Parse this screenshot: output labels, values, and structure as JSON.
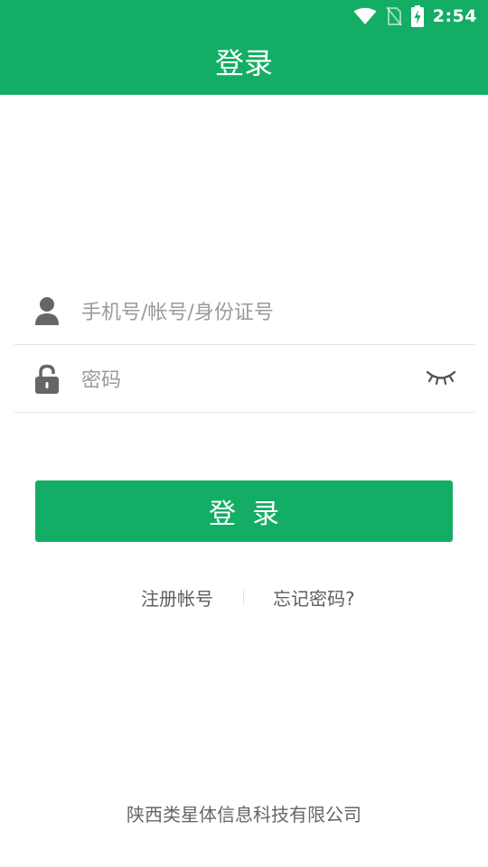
{
  "status_bar": {
    "time": "2:54",
    "icons": [
      "wifi-icon",
      "no-sim-icon",
      "battery-charging-icon"
    ]
  },
  "header": {
    "title": "登录"
  },
  "form": {
    "account": {
      "icon": "person-icon",
      "placeholder": "手机号/帐号/身份证号",
      "value": ""
    },
    "password": {
      "icon": "lock-icon",
      "placeholder": "密码",
      "value": "",
      "visibility_icon": "eye-closed-icon"
    },
    "login_label": "登录"
  },
  "links": {
    "register": "注册帐号",
    "forgot_password": "忘记密码?"
  },
  "footer": {
    "company": "陕西类星体信息科技有限公司"
  },
  "colors": {
    "primary": "#14ad65",
    "icon_gray": "#666666",
    "placeholder": "#9a9a9a",
    "divider": "#e6e6e6"
  }
}
